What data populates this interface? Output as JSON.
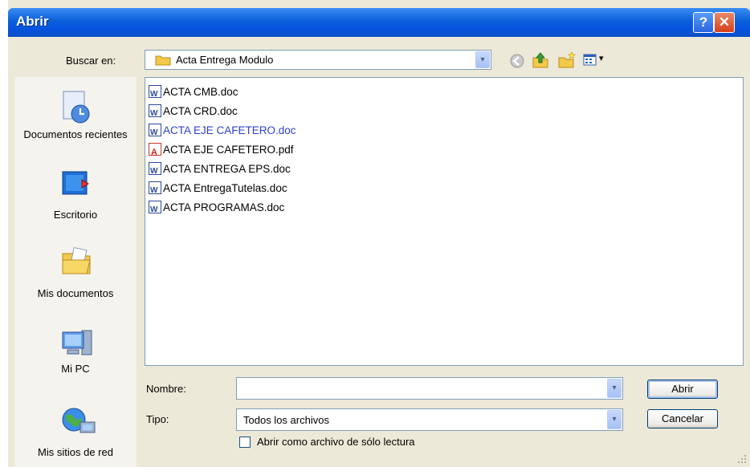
{
  "window": {
    "title": "Abrir",
    "help_glyph": "?",
    "close_glyph": "✕"
  },
  "lookin": {
    "label": "Buscar en:",
    "value": "Acta Entrega Modulo",
    "dropdown_glyph": "▾"
  },
  "toolbar": {
    "icons": [
      "back-icon",
      "up-folder-icon",
      "new-folder-icon",
      "view-menu-icon"
    ],
    "view_arrow": "▾"
  },
  "places": [
    {
      "label": "Documentos recientes",
      "icon": "recent-documents-icon"
    },
    {
      "label": "Escritorio",
      "icon": "desktop-icon"
    },
    {
      "label": "Mis documentos",
      "icon": "my-documents-icon"
    },
    {
      "label": "Mi PC",
      "icon": "my-computer-icon"
    },
    {
      "label": "Mis sitios de red",
      "icon": "network-places-icon"
    }
  ],
  "files": [
    {
      "name": "ACTA CMB.doc",
      "type": "doc"
    },
    {
      "name": "ACTA CRD.doc",
      "type": "doc"
    },
    {
      "name": "ACTA EJE CAFETERO.doc",
      "type": "doc"
    },
    {
      "name": "ACTA EJE CAFETERO.pdf",
      "type": "pdf"
    },
    {
      "name": "ACTA ENTREGA EPS.doc",
      "type": "doc"
    },
    {
      "name": "ACTA EntregaTutelas.doc",
      "type": "doc"
    },
    {
      "name": "ACTA PROGRAMAS.doc",
      "type": "doc"
    }
  ],
  "filename": {
    "label": "Nombre:",
    "value": ""
  },
  "filetype": {
    "label": "Tipo:",
    "value": "Todos los archivos"
  },
  "readonly": {
    "label": "Abrir como archivo de sólo lectura",
    "checked": false
  },
  "buttons": {
    "open": "Abrir",
    "cancel": "Cancelar"
  },
  "colors": {
    "titlebar": "#0a5fd8",
    "highlight_text": "#2b3fd0",
    "dialog_bg": "#ece9d8"
  }
}
